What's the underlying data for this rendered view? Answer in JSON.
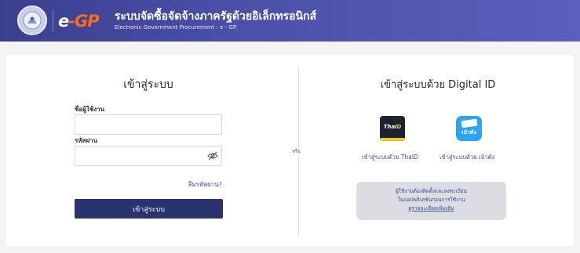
{
  "header": {
    "logo_main": "e",
    "logo_dash": "-",
    "logo_gp": "GP",
    "title": "ระบบจัดซื้อจัดจ้างภาครัฐด้วยอิเล็กทรอนิกส์",
    "subtitle": "Electronic Government Procurement : e - GP"
  },
  "login": {
    "title": "เข้าสู่ระบบ",
    "username_label": "ชื่อผู้ใช้งาน",
    "username_value": "",
    "password_label": "รหัสผ่าน",
    "password_value": "",
    "forgot_label": "ลืมรหัสผ่าน?",
    "submit_label": "เข้าสู่ระบบ"
  },
  "divider_label": "หรือ",
  "digital_id": {
    "title": "เข้าสู่ระบบด้วย Digital ID",
    "thaid": {
      "logo_a": "Thai",
      "logo_b": "D",
      "caption": "เข้าสู่ระบบด้วย ThaID"
    },
    "paotang": {
      "logo": "เป๋าตัง",
      "caption": "เข้าสู่ระบบด้วย เป๋าตัง"
    },
    "info_line1": "ผู้ใช้งานต้องติดตั้งและลงทะเบียน",
    "info_line2": "ในแอปพลิเคชันก่อนการใช้งาน",
    "info_link": "ดูรายละเอียดเพิ่มเติม"
  },
  "colors": {
    "header_bg": "#4a4fa8",
    "accent_orange": "#ff6a1f",
    "button_bg": "#2b3270",
    "link": "#3a50b4"
  }
}
